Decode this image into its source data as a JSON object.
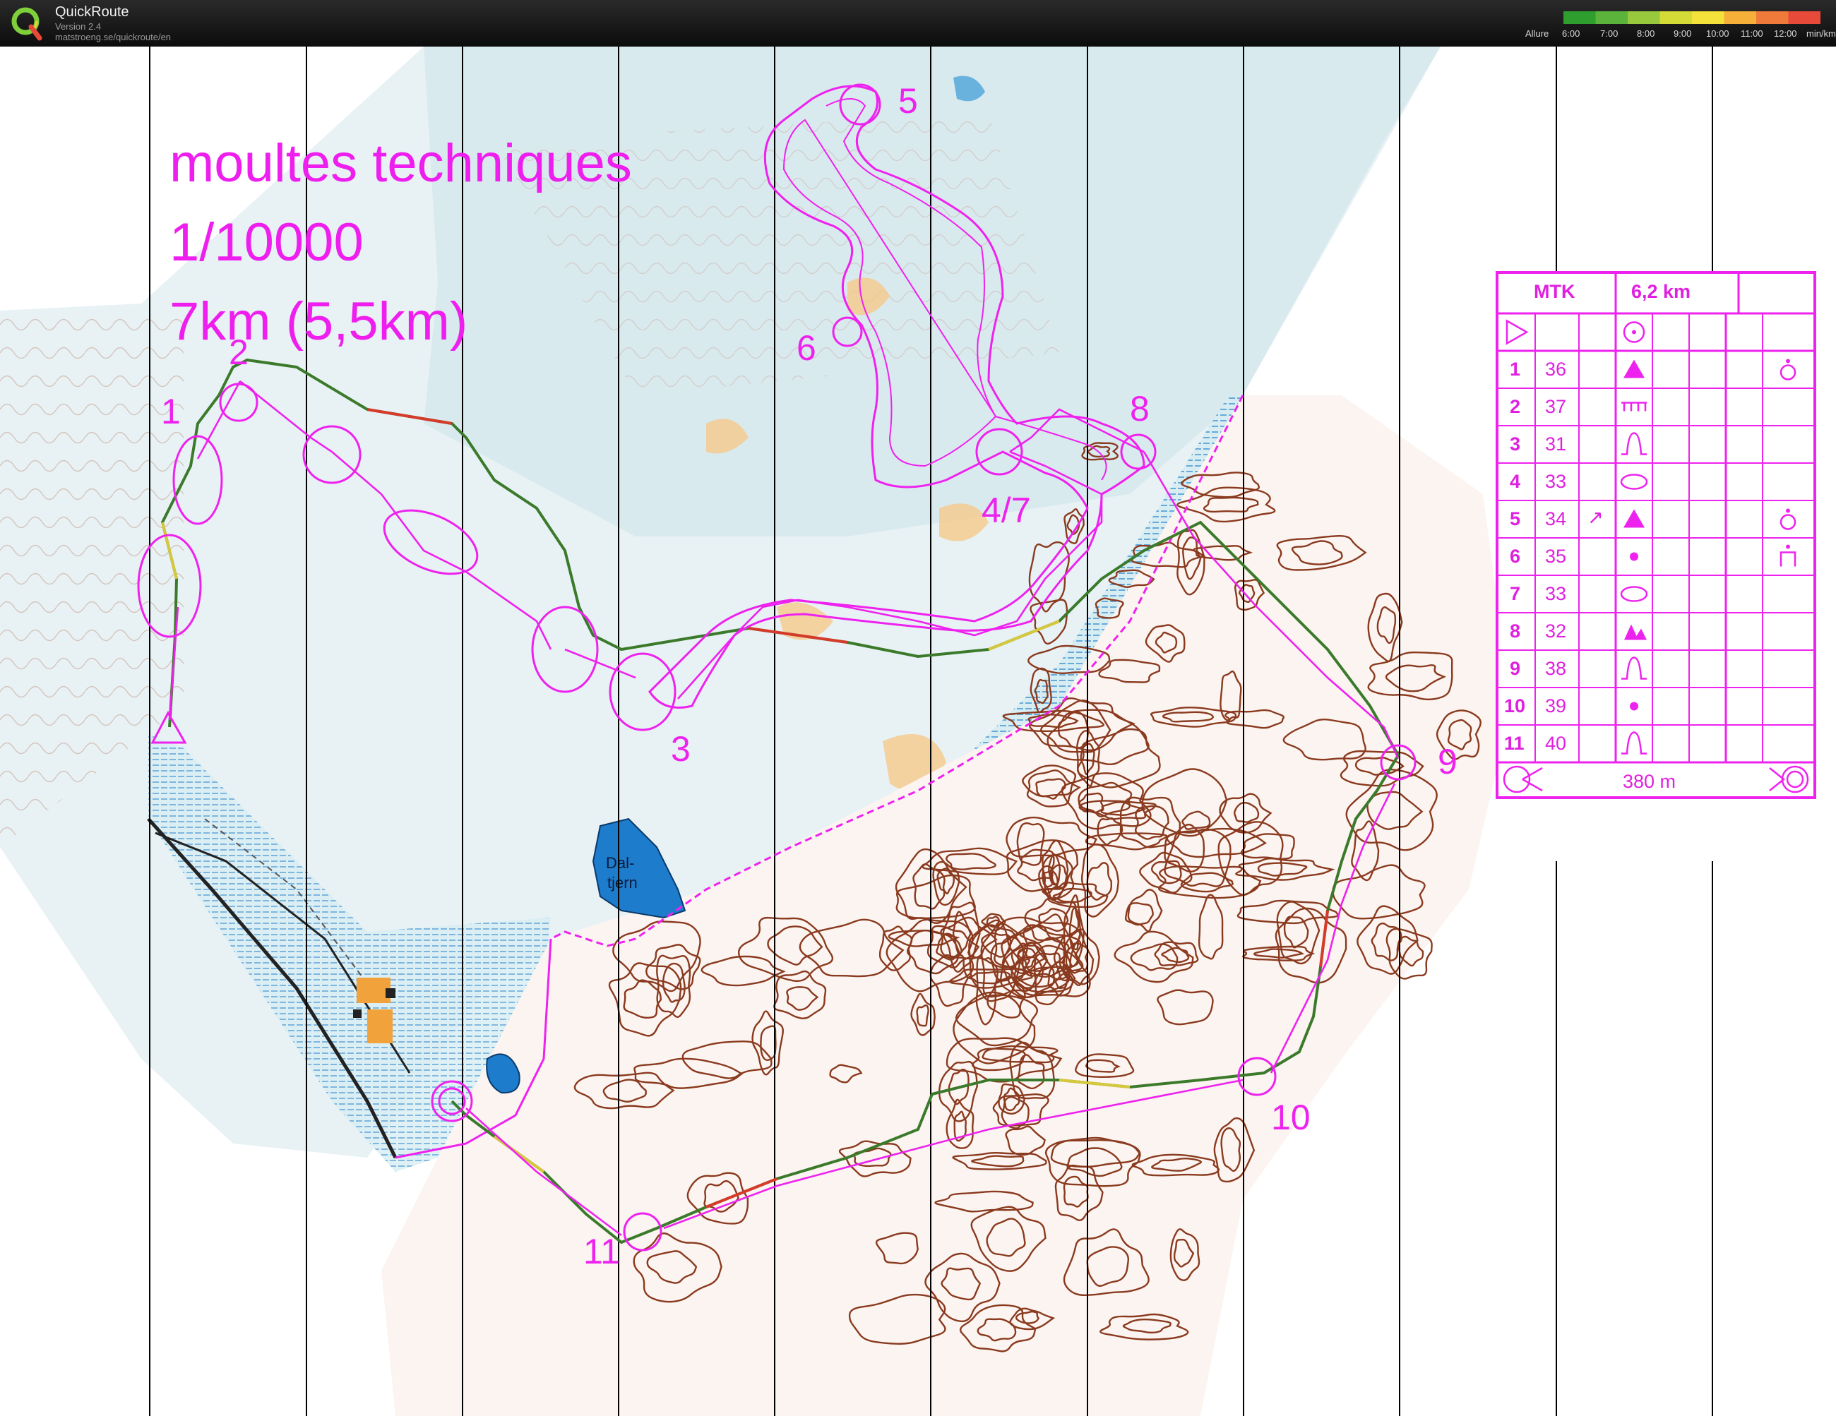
{
  "app": {
    "title": "QuickRoute",
    "version": "Version 2.4",
    "url": "matstroeng.se/quickroute/en",
    "legend_label": "Allure",
    "legend_ticks": [
      "6:00",
      "7:00",
      "8:00",
      "9:00",
      "10:00",
      "11:00",
      "12:00"
    ],
    "legend_unit": "min/km",
    "legend_colors": [
      "#2e9e2e",
      "#5cb33b",
      "#98c83c",
      "#d4da36",
      "#f4e23a",
      "#f6b03a",
      "#f07a3a",
      "#e84a3a"
    ]
  },
  "course": {
    "title_lines": [
      "moultes techniques",
      "1/10000",
      "7km (5,5km)"
    ],
    "control_numbers": [
      "1",
      "2",
      "3",
      "4/7",
      "5",
      "6",
      "8",
      "9",
      "10",
      "11"
    ],
    "lake_name": [
      "Dal-",
      "tjern"
    ]
  },
  "control_card": {
    "event": "MTK",
    "length": "6,2 km",
    "rows": [
      {
        "num": "1",
        "code": "36",
        "dir": "",
        "feature": "triangle",
        "appear": "water-point"
      },
      {
        "num": "2",
        "code": "37",
        "dir": "",
        "feature": "fence",
        "appear": ""
      },
      {
        "num": "3",
        "code": "31",
        "dir": "",
        "feature": "reentrant",
        "appear": ""
      },
      {
        "num": "4",
        "code": "33",
        "dir": "",
        "feature": "ellipse",
        "appear": ""
      },
      {
        "num": "5",
        "code": "34",
        "dir": "↗",
        "feature": "triangle",
        "appear": "water-point"
      },
      {
        "num": "6",
        "code": "35",
        "dir": "",
        "feature": "dot",
        "appear": "first-aid"
      },
      {
        "num": "7",
        "code": "33",
        "dir": "",
        "feature": "ellipse",
        "appear": ""
      },
      {
        "num": "8",
        "code": "32",
        "dir": "",
        "feature": "boulders",
        "appear": ""
      },
      {
        "num": "9",
        "code": "38",
        "dir": "",
        "feature": "reentrant",
        "appear": ""
      },
      {
        "num": "10",
        "code": "39",
        "dir": "",
        "feature": "dot",
        "appear": ""
      },
      {
        "num": "11",
        "code": "40",
        "dir": "",
        "feature": "reentrant",
        "appear": ""
      }
    ],
    "finish_distance": "380 m"
  },
  "colors": {
    "course": "#ee22ee",
    "contour": "#8a3a1e",
    "water": "#1e7ccc",
    "vegetation": "#cfe7ee",
    "open": "#f5c98a"
  }
}
